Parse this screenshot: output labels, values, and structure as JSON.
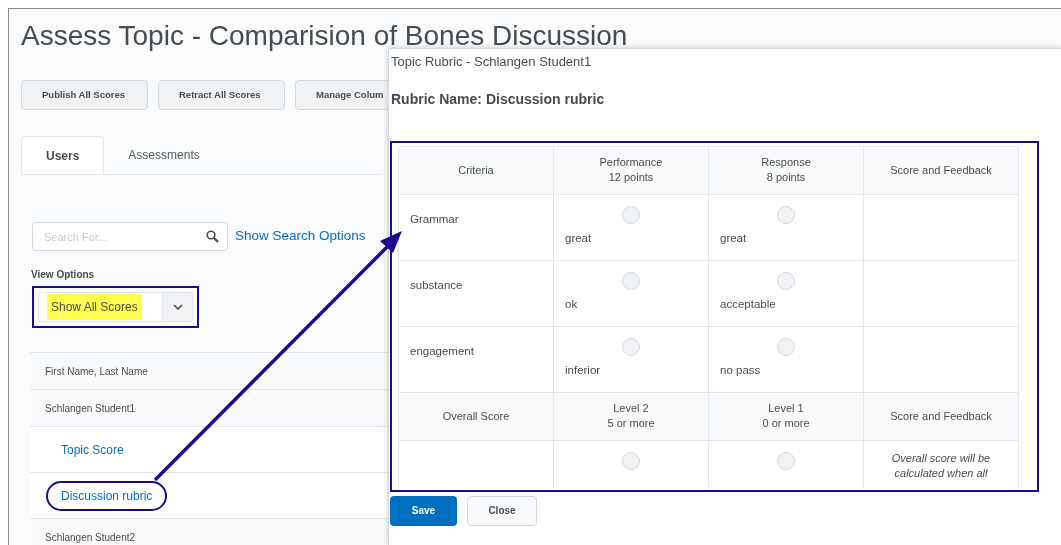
{
  "page": {
    "title": "Assess Topic - Comparision of Bones Discussion",
    "buttons": [
      "Publish All Scores",
      "Retract All Scores",
      "Manage Colum"
    ],
    "tabs": [
      {
        "label": "Users",
        "selected": true
      },
      {
        "label": "Assessments",
        "selected": false
      }
    ],
    "search": {
      "placeholder": "Search For...",
      "options_link": "Show Search Options"
    },
    "view_options": {
      "label": "View Options",
      "value": "Show All Scores",
      "highlighted": true
    },
    "users_table": {
      "header": "First Name, Last Name",
      "rows": [
        {
          "kind": "user",
          "text": "Schlangen Student1"
        },
        {
          "kind": "link",
          "text": "Topic Score",
          "circled": false
        },
        {
          "kind": "link",
          "text": "Discussion rubric",
          "circled": true
        },
        {
          "kind": "user",
          "text": "Schlangen Student2"
        }
      ]
    }
  },
  "dialog": {
    "title": "Topic Rubric - Schlangen Student1",
    "rubric_name": "Rubric Name: Discussion rubric",
    "columns": [
      {
        "title": "Criteria"
      },
      {
        "title": "Performance",
        "sub": "12 points"
      },
      {
        "title": "Response",
        "sub": "8 points"
      },
      {
        "title": "Score and Feedback"
      }
    ],
    "rows": [
      {
        "criterion": "Grammar",
        "levels": [
          {
            "text": "great",
            "selected": false
          },
          {
            "text": "great",
            "selected": false
          }
        ]
      },
      {
        "criterion": "substance",
        "levels": [
          {
            "text": "ok",
            "selected": false
          },
          {
            "text": "acceptable",
            "selected": false
          }
        ]
      },
      {
        "criterion": "engagement",
        "levels": [
          {
            "text": "inferior",
            "selected": false
          },
          {
            "text": "no pass",
            "selected": false
          }
        ]
      }
    ],
    "overall_columns": [
      {
        "title": "Overall Score"
      },
      {
        "title": "Level 2",
        "sub": "5 or more"
      },
      {
        "title": "Level 1",
        "sub": "0 or more"
      },
      {
        "title": "Score and Feedback"
      }
    ],
    "overall_row": {
      "levels": [
        {
          "selected": false
        },
        {
          "selected": false
        }
      ],
      "note": "Overall score will be calculated when all"
    },
    "buttons": [
      {
        "label": "Save",
        "kind": "primary"
      },
      {
        "label": "Close",
        "kind": "secondary"
      }
    ]
  }
}
